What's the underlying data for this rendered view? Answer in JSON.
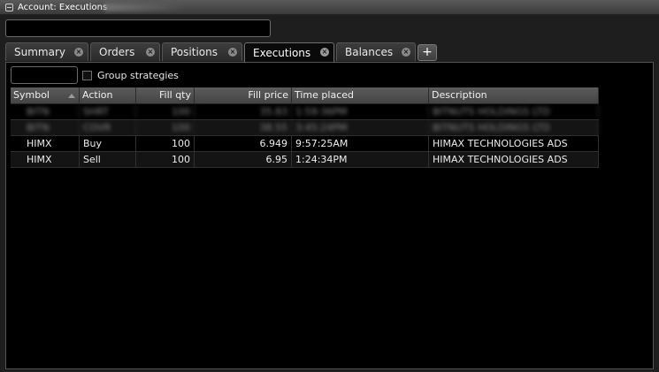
{
  "window": {
    "title": "Account: Executions"
  },
  "tabs": [
    {
      "label": "Summary"
    },
    {
      "label": "Orders"
    },
    {
      "label": "Positions"
    },
    {
      "label": "Executions"
    },
    {
      "label": "Balances"
    }
  ],
  "active_tab": "Executions",
  "add_tab_label": "+",
  "close_glyph": "×",
  "filter": {
    "value": ""
  },
  "group_strategies": {
    "label": "Group strategies",
    "checked": false
  },
  "table": {
    "columns": [
      "Symbol",
      "Action",
      "Fill qty",
      "Fill price",
      "Time placed",
      "Description"
    ],
    "rows": [
      {
        "symbol": "BITN",
        "action": "SHRT",
        "qty": "100",
        "price": "35.83",
        "time": "1:59:36PM",
        "desc": "BITNUTS HOLDINGS LTD",
        "redacted": true
      },
      {
        "symbol": "BITN",
        "action": "COVR",
        "qty": "100",
        "price": "38.55",
        "time": "3:45:24PM",
        "desc": "BITNUTS HOLDINGS LTD",
        "redacted": true
      },
      {
        "symbol": "HIMX",
        "action": "Buy",
        "qty": "100",
        "price": "6.949",
        "time": "9:57:25AM",
        "desc": "HIMAX TECHNOLOGIES ADS",
        "redacted": false
      },
      {
        "symbol": "HIMX",
        "action": "Sell",
        "qty": "100",
        "price": "6.95",
        "time": "1:24:34PM",
        "desc": "HIMAX TECHNOLOGIES ADS",
        "redacted": false
      }
    ]
  }
}
